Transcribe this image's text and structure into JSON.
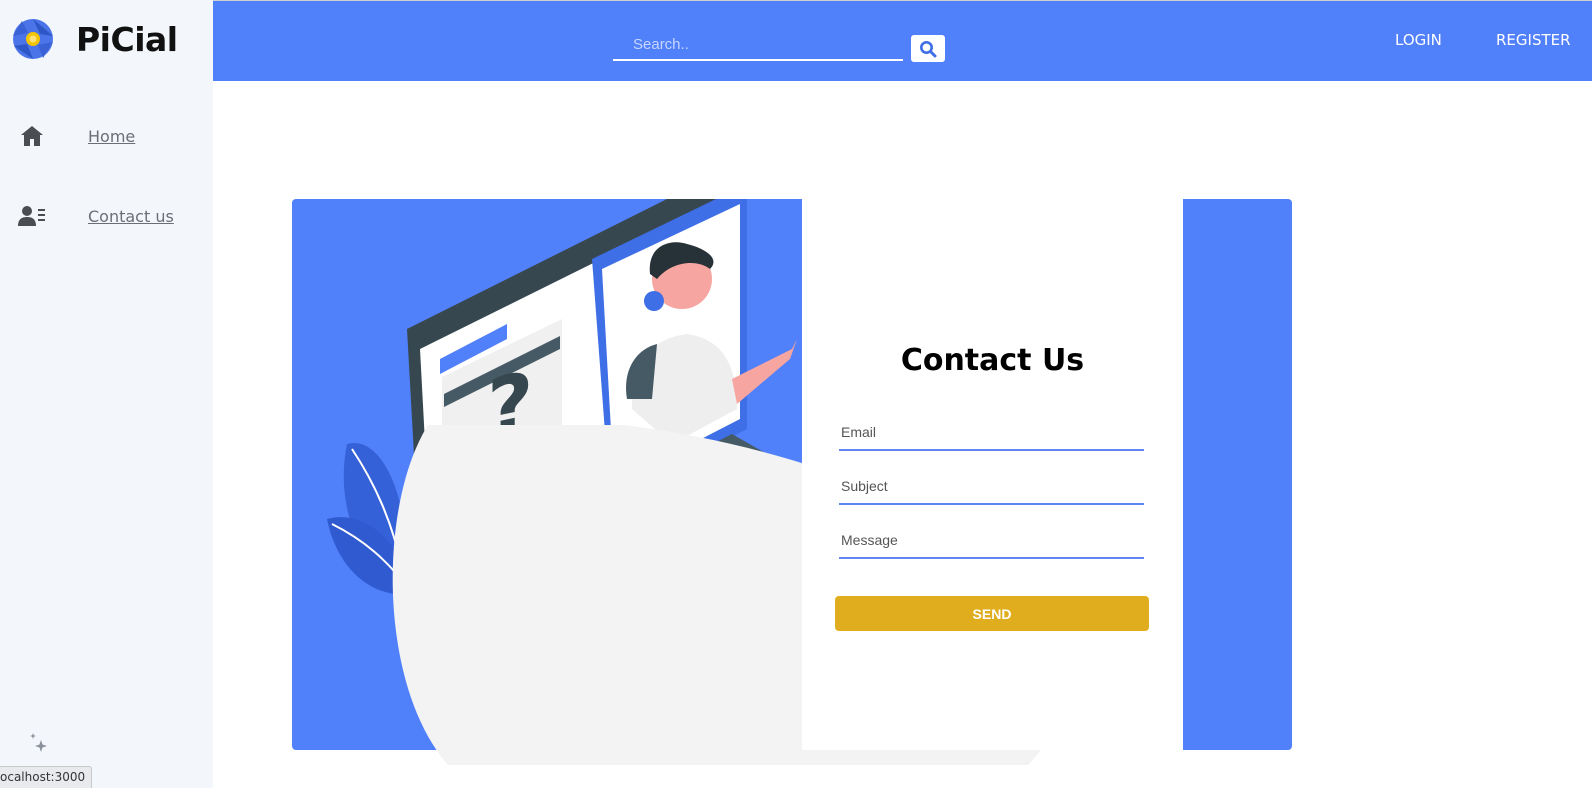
{
  "brand": {
    "name": "PiCial",
    "logo_icon": "camera-aperture-icon"
  },
  "sidebar": {
    "items": [
      {
        "label": "Home",
        "icon": "home-icon"
      },
      {
        "label": "Contact us",
        "icon": "contact-card-icon"
      }
    ]
  },
  "header": {
    "search_placeholder": "Search..",
    "search_icon": "search-icon",
    "login_label": "LOGIN",
    "register_label": "REGISTER"
  },
  "contact_form": {
    "title": "Contact Us",
    "email_placeholder": "Email",
    "subject_placeholder": "Subject",
    "message_placeholder": "Message",
    "send_label": "SEND"
  },
  "status_bar": {
    "url": "ocalhost:3000"
  },
  "colors": {
    "accent": "#5180fb",
    "send": "#dfad1d",
    "sidebar_bg": "#f3f7fc"
  }
}
